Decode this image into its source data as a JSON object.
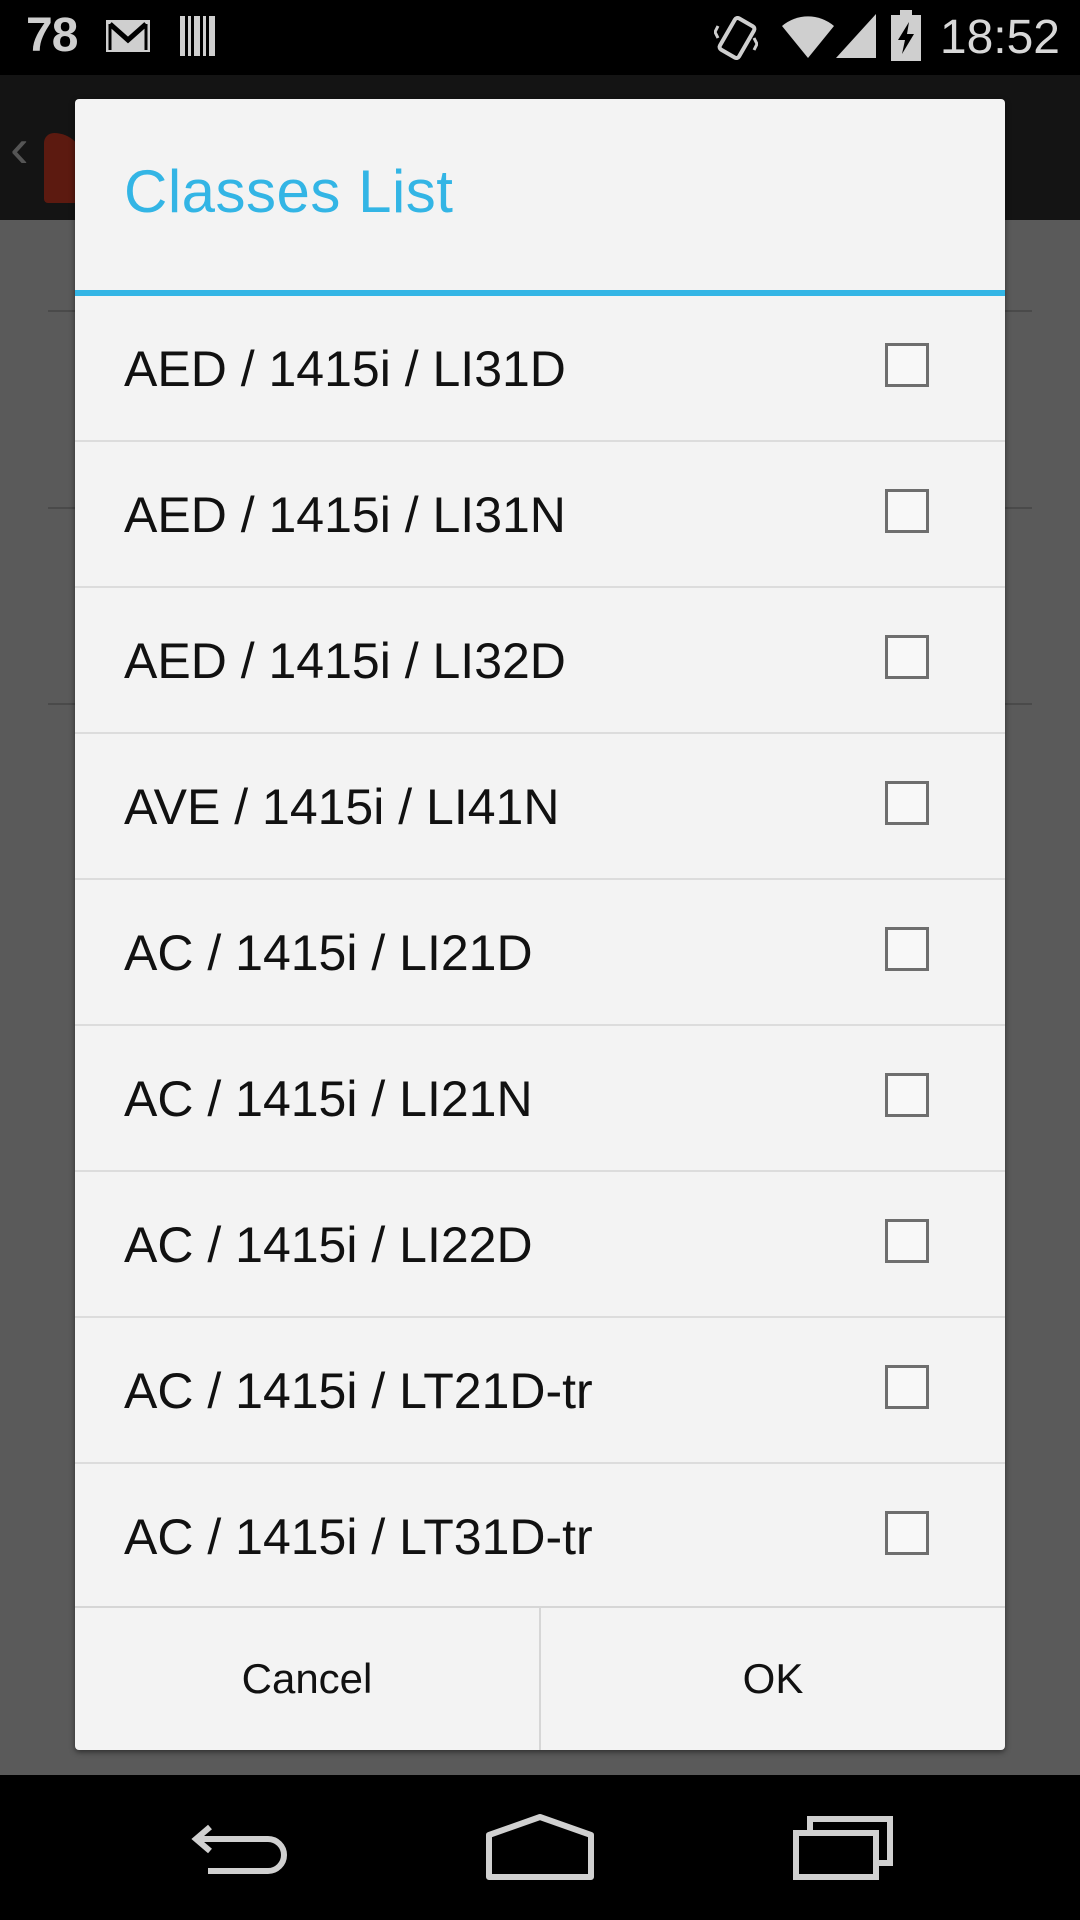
{
  "status_bar": {
    "battery_percent": "78",
    "time": "18:52",
    "icons": [
      "gmail-icon",
      "barcode-icon",
      "vibrate-icon",
      "wifi-icon",
      "signal-icon",
      "battery-charging-icon"
    ]
  },
  "dialog": {
    "title": "Classes List",
    "items": [
      {
        "label": "AED / 1415i / LI31D",
        "checked": false
      },
      {
        "label": "AED / 1415i / LI31N",
        "checked": false
      },
      {
        "label": "AED / 1415i / LI32D",
        "checked": false
      },
      {
        "label": "AVE / 1415i / LI41N",
        "checked": false
      },
      {
        "label": "AC / 1415i / LI21D",
        "checked": false
      },
      {
        "label": "AC / 1415i / LI21N",
        "checked": false
      },
      {
        "label": "AC / 1415i / LI22D",
        "checked": false
      },
      {
        "label": "AC / 1415i / LT21D-tr",
        "checked": false
      },
      {
        "label": "AC / 1415i / LT31D-tr",
        "checked": false
      }
    ],
    "cancel_label": "Cancel",
    "ok_label": "OK"
  },
  "nav_bar": {
    "icons": [
      "back-icon",
      "home-icon",
      "recent-apps-icon"
    ]
  },
  "colors": {
    "accent": "#33b5e5",
    "dialog_background": "#f3f3f3"
  }
}
